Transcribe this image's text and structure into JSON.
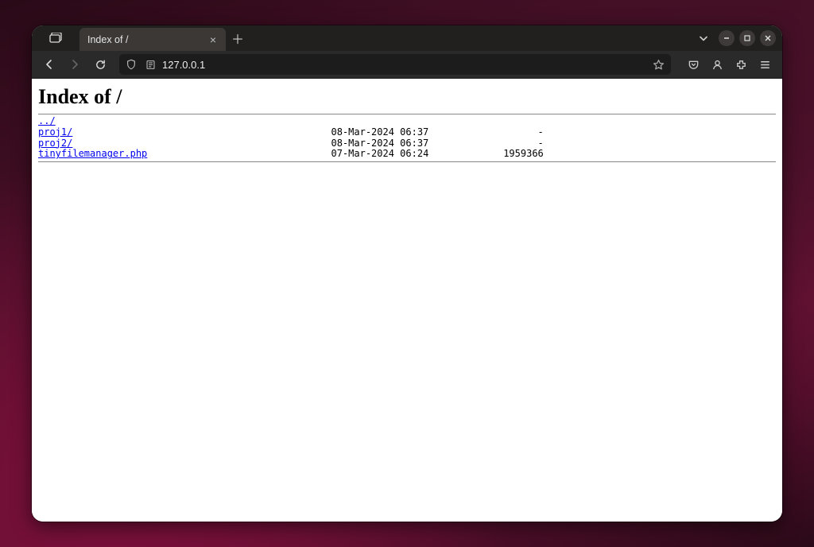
{
  "tab": {
    "title": "Index of /"
  },
  "address": {
    "url": "127.0.0.1"
  },
  "page": {
    "heading": "Index of /",
    "parent_link": "../",
    "entries": [
      {
        "name": "proj1/",
        "date": "08-Mar-2024 06:37",
        "size": "-"
      },
      {
        "name": "proj2/",
        "date": "08-Mar-2024 06:37",
        "size": "-"
      },
      {
        "name": "tinyfilemanager.php",
        "date": "07-Mar-2024 06:24",
        "size": "1959366"
      }
    ]
  },
  "layout": {
    "name_col_width": 51,
    "date_col_width": 17,
    "size_col_width": 19
  }
}
